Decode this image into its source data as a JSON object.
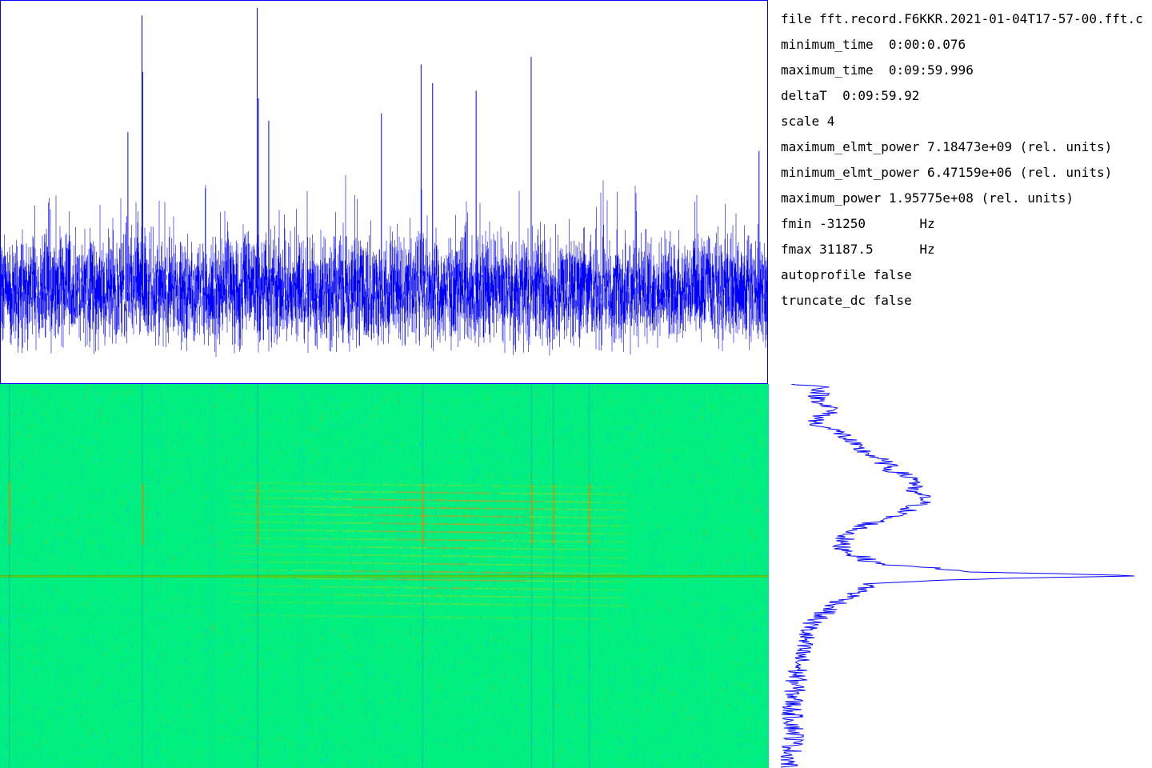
{
  "info": {
    "file": "file fft.record.F6KKR.2021-01-04T17-57-00.fft.c",
    "minimum_time": "minimum_time  0:00:0.076",
    "maximum_time": "maximum_time  0:09:59.996",
    "deltaT": "deltaT  0:09:59.92",
    "scale": "scale 4",
    "maximum_elmt_power": "maximum_elmt_power 7.18473e+09 (rel. units)",
    "minimum_elmt_power": "minimum_elmt_power 6.47159e+06 (rel. units)",
    "maximum_power": "maximum_power 1.95775e+08 (rel. units)",
    "fmin": "fmin -31250       Hz",
    "fmax": "fmax 31187.5      Hz",
    "autoprofile": "autoprofile false",
    "truncate_dc": "truncate_dc false"
  },
  "colors": {
    "trace": "#0000ff",
    "spectrogram_background": "#00f080",
    "spectrogram_faint": "#20d860",
    "spectrogram_mid": "#a0e000",
    "spectrogram_peak": "#ff8800",
    "spectrogram_dc_line": "#40c020",
    "border": "#0000ff"
  },
  "chart_data": [
    {
      "type": "line",
      "name": "total power vs time",
      "x_range_s": [
        0.076,
        599.996
      ],
      "baseline": 0.25,
      "noise_band": 0.12,
      "spikes": [
        {
          "t": 111.0,
          "value": 0.98
        },
        {
          "t": 111.5,
          "value": 0.83
        },
        {
          "t": 201.0,
          "value": 1.0
        },
        {
          "t": 202.0,
          "value": 0.76
        },
        {
          "t": 329.0,
          "value": 0.85
        },
        {
          "t": 415.0,
          "value": 0.87
        },
        {
          "t": 372.0,
          "value": 0.78
        },
        {
          "t": 338.0,
          "value": 0.8
        },
        {
          "t": 100.0,
          "value": 0.67
        },
        {
          "t": 210.0,
          "value": 0.7
        },
        {
          "t": 298.0,
          "value": 0.72
        },
        {
          "t": 593.0,
          "value": 0.62
        }
      ]
    },
    {
      "type": "heatmap",
      "name": "spectrogram",
      "x_range_s": [
        0.076,
        599.996
      ],
      "y_range_hz": [
        31187.5,
        -31250
      ],
      "dc_line_hz": 0,
      "impulse_times_s": [
        7,
        111,
        201,
        330,
        415,
        432,
        460
      ],
      "tone_lines": [
        {
          "t_start": 230,
          "t_end": 410,
          "f_start": 15200,
          "f_end": 14500,
          "strength": 0.4
        },
        {
          "t_start": 230,
          "t_end": 420,
          "f_start": 14000,
          "f_end": 13300,
          "strength": 0.7
        },
        {
          "t_start": 230,
          "t_end": 420,
          "f_start": 12800,
          "f_end": 12000,
          "strength": 0.9
        },
        {
          "t_start": 230,
          "t_end": 420,
          "f_start": 11500,
          "f_end": 10800,
          "strength": 0.9
        },
        {
          "t_start": 230,
          "t_end": 420,
          "f_start": 10200,
          "f_end": 9500,
          "strength": 0.8
        },
        {
          "t_start": 230,
          "t_end": 420,
          "f_start": 8900,
          "f_end": 8200,
          "strength": 0.8
        },
        {
          "t_start": 230,
          "t_end": 420,
          "f_start": 7600,
          "f_end": 6900,
          "strength": 0.8
        },
        {
          "t_start": 230,
          "t_end": 420,
          "f_start": 6300,
          "f_end": 5600,
          "strength": 0.7
        },
        {
          "t_start": 230,
          "t_end": 420,
          "f_start": 5000,
          "f_end": 4300,
          "strength": 0.6
        },
        {
          "t_start": 230,
          "t_end": 420,
          "f_start": 3700,
          "f_end": 3000,
          "strength": 0.5
        },
        {
          "t_start": 230,
          "t_end": 420,
          "f_start": 2400,
          "f_end": 1700,
          "strength": 0.6
        },
        {
          "t_start": 230,
          "t_end": 420,
          "f_start": 1100,
          "f_end": 400,
          "strength": 0.9
        },
        {
          "t_start": 230,
          "t_end": 420,
          "f_start": -200,
          "f_end": -900,
          "strength": 0.8
        },
        {
          "t_start": 230,
          "t_end": 420,
          "f_start": -1500,
          "f_end": -2200,
          "strength": 0.6
        },
        {
          "t_start": 230,
          "t_end": 420,
          "f_start": -2800,
          "f_end": -3500,
          "strength": 0.5
        },
        {
          "t_start": 230,
          "t_end": 420,
          "f_start": -4100,
          "f_end": -4800,
          "strength": 0.4
        },
        {
          "t_start": 240,
          "t_end": 400,
          "f_start": -6300,
          "f_end": -6900,
          "strength": 0.3
        }
      ]
    },
    {
      "type": "line",
      "name": "frequency profile",
      "y_range_hz": [
        31187.5,
        -31250
      ],
      "points": [
        {
          "f": 31000,
          "value": 0.12
        },
        {
          "f": 29000,
          "value": 0.1
        },
        {
          "f": 27000,
          "value": 0.14
        },
        {
          "f": 25000,
          "value": 0.09
        },
        {
          "f": 23000,
          "value": 0.17
        },
        {
          "f": 21000,
          "value": 0.2
        },
        {
          "f": 19000,
          "value": 0.27
        },
        {
          "f": 17000,
          "value": 0.31
        },
        {
          "f": 15500,
          "value": 0.38
        },
        {
          "f": 14000,
          "value": 0.35
        },
        {
          "f": 12500,
          "value": 0.4
        },
        {
          "f": 11000,
          "value": 0.36
        },
        {
          "f": 9500,
          "value": 0.3
        },
        {
          "f": 8000,
          "value": 0.22
        },
        {
          "f": 6500,
          "value": 0.18
        },
        {
          "f": 5000,
          "value": 0.16
        },
        {
          "f": 3500,
          "value": 0.2
        },
        {
          "f": 2000,
          "value": 0.26
        },
        {
          "f": 600,
          "value": 0.55
        },
        {
          "f": 0,
          "value": 1.0
        },
        {
          "f": -400,
          "value": 0.6
        },
        {
          "f": -1200,
          "value": 0.25
        },
        {
          "f": -2500,
          "value": 0.22
        },
        {
          "f": -4000,
          "value": 0.17
        },
        {
          "f": -6000,
          "value": 0.12
        },
        {
          "f": -8000,
          "value": 0.08
        },
        {
          "f": -11000,
          "value": 0.06
        },
        {
          "f": -14000,
          "value": 0.05
        },
        {
          "f": -18000,
          "value": 0.04
        },
        {
          "f": -22000,
          "value": 0.03
        },
        {
          "f": -26000,
          "value": 0.04
        },
        {
          "f": -31000,
          "value": 0.02
        }
      ]
    }
  ]
}
